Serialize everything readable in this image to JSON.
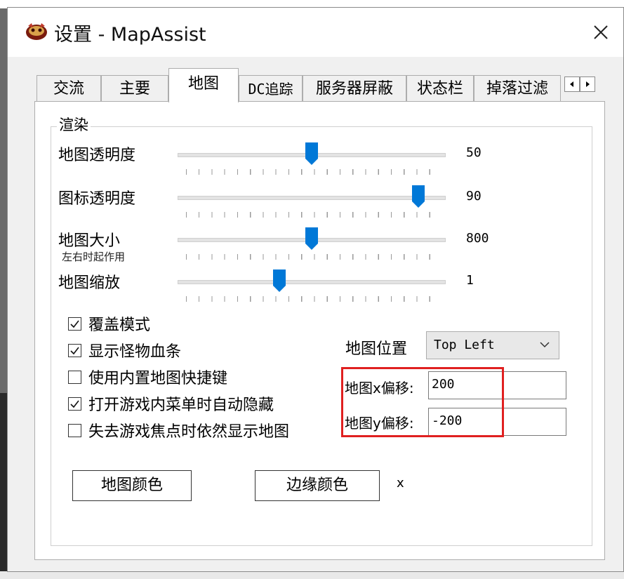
{
  "window": {
    "title": "设置 - MapAssist"
  },
  "tabs": [
    {
      "label": "交流"
    },
    {
      "label": "主要"
    },
    {
      "label": "地图"
    },
    {
      "label": "DC追踪"
    },
    {
      "label": "服务器屏蔽"
    },
    {
      "label": "状态栏"
    },
    {
      "label": "掉落过滤"
    }
  ],
  "active_tab": "地图",
  "render_group": {
    "label": "渲染",
    "sliders": [
      {
        "label": "地图透明度",
        "value": "50",
        "level": 0.5
      },
      {
        "label": "图标透明度",
        "value": "90",
        "level": 0.9
      },
      {
        "label": "地图大小",
        "value": "800",
        "level": 0.5,
        "note": "左右时起作用"
      },
      {
        "label": "地图缩放",
        "value": "1",
        "level": 0.38
      }
    ]
  },
  "checkboxes": [
    {
      "label": "覆盖模式",
      "checked": true
    },
    {
      "label": "显示怪物血条",
      "checked": true
    },
    {
      "label": "使用内置地图快捷键",
      "checked": false
    },
    {
      "label": "打开游戏内菜单时自动隐藏",
      "checked": true
    },
    {
      "label": "失去游戏焦点时依然显示地图",
      "checked": false
    }
  ],
  "map_position": {
    "label": "地图位置",
    "selected": "Top Left"
  },
  "offsets": {
    "x_label": "地图x偏移:",
    "x_value": "200",
    "y_label": "地图y偏移:",
    "y_value": "-200"
  },
  "buttons": {
    "map_color": "地图颜色",
    "border_color": "边缘颜色",
    "border_color_value": "x"
  },
  "colors": {
    "slider_thumb": "#0078d7",
    "highlight": "#e02020"
  }
}
